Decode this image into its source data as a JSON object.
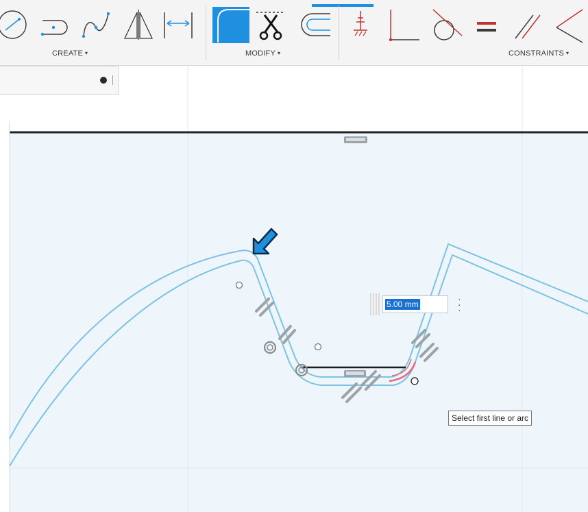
{
  "toolbar": {
    "groups": [
      {
        "label": "CREATE",
        "caret": "▾"
      },
      {
        "label": "MODIFY",
        "caret": "▾"
      },
      {
        "label": "CONSTRAINTS",
        "caret": "▾"
      }
    ],
    "icons": [
      "circle-icon",
      "slot-icon",
      "spline-icon",
      "mirror-icon",
      "dimension-icon",
      "fillet-icon",
      "trim-icon",
      "offset-icon",
      "fix-constraint-icon",
      "perpendicular-icon",
      "tangent-icon",
      "equal-icon",
      "parallel-icon",
      "collinear-icon"
    ],
    "active_tool": "fillet",
    "colors": {
      "accent": "#1f8fe0",
      "constraint_red": "#c4312f"
    }
  },
  "dimension_input": {
    "value": "5.00 mm"
  },
  "tooltip": {
    "text": "Select first line or arc"
  },
  "canvas": {
    "sketch_profile_color": "#7cc3e3",
    "fillet_preview_color": "#e36a7a",
    "background": "#eef6fb"
  }
}
